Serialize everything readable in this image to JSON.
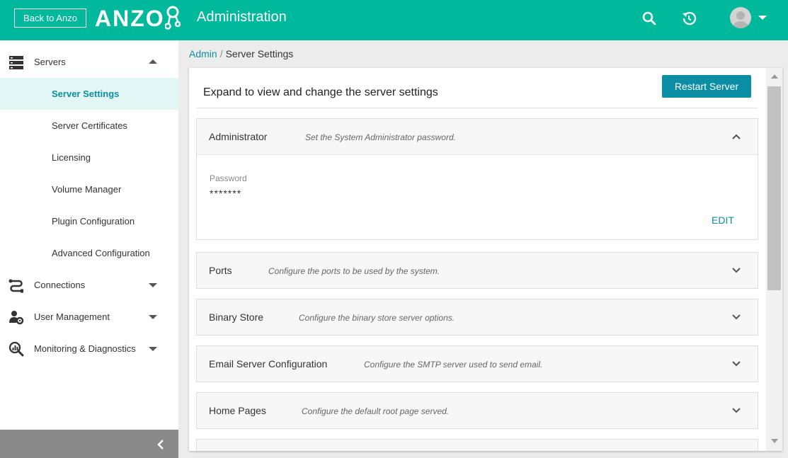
{
  "header": {
    "back_label": "Back to Anzo",
    "logo_text": "ANZO",
    "app_title": "Administration",
    "accent_color": "#00b99c"
  },
  "sidebar": {
    "groups": [
      {
        "label": "Servers",
        "icon": "server-icon",
        "expanded": true
      },
      {
        "label": "Connections",
        "icon": "connections-icon",
        "expanded": false
      },
      {
        "label": "User Management",
        "icon": "users-gear-icon",
        "expanded": false
      },
      {
        "label": "Monitoring & Diagnostics",
        "icon": "monitoring-icon",
        "expanded": false
      }
    ],
    "server_items": [
      {
        "label": "Server Settings",
        "active": true
      },
      {
        "label": "Server Certificates",
        "active": false
      },
      {
        "label": "Licensing",
        "active": false
      },
      {
        "label": "Volume Manager",
        "active": false
      },
      {
        "label": "Plugin Configuration",
        "active": false
      },
      {
        "label": "Advanced Configuration",
        "active": false
      }
    ]
  },
  "breadcrumb": {
    "root": "Admin",
    "separator": "/",
    "current": "Server Settings"
  },
  "main": {
    "heading": "Expand to view and change the server settings",
    "restart_label": "Restart Server",
    "sections": [
      {
        "title": "Administrator",
        "description": "Set the System Administrator password.",
        "expanded": true
      },
      {
        "title": "Ports",
        "description": "Configure the ports to be used by the system.",
        "expanded": false
      },
      {
        "title": "Binary Store",
        "description": "Configure the binary store server options.",
        "expanded": false
      },
      {
        "title": "Email Server Configuration",
        "description": "Configure the SMTP server used to send email.",
        "expanded": false
      },
      {
        "title": "Home Pages",
        "description": "Configure the default root page served.",
        "expanded": false
      }
    ],
    "admin_body": {
      "password_label": "Password",
      "password_value": "*******",
      "edit_label": "EDIT"
    }
  }
}
